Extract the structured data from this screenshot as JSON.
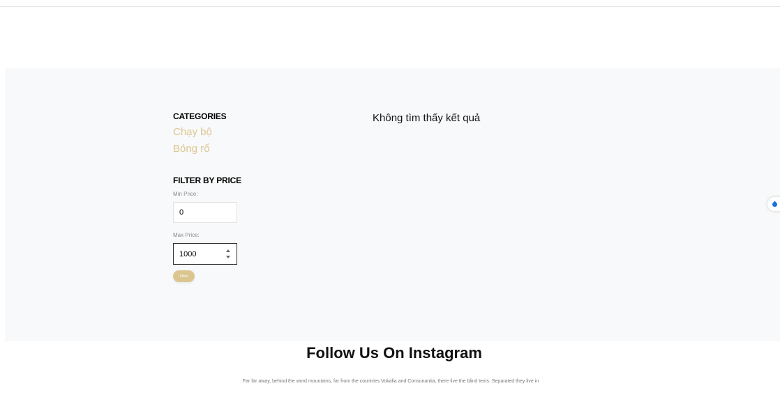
{
  "sidebar": {
    "categories_heading": "CATEGORIES",
    "categories": [
      {
        "label": "Chạy bộ"
      },
      {
        "label": "Bóng rổ"
      }
    ],
    "price_filter": {
      "heading": "FILTER BY PRICE",
      "min_label": "Min Price:",
      "min_value": "0",
      "max_label": "Max Price:",
      "max_value": "1000",
      "button_label": "Filter"
    }
  },
  "results": {
    "empty_message": "Không tìm thấy kết quả"
  },
  "instagram": {
    "title": "Follow Us On Instagram",
    "description": "Far far away, behind the word mountains, far from the countries Vokalia and Consonantia, there live the blind texts. Separated they live in"
  },
  "widget": {
    "icon": "water-drop-icon"
  },
  "colors": {
    "accent": "#dcc690",
    "section_background": "#f8f9fa"
  }
}
